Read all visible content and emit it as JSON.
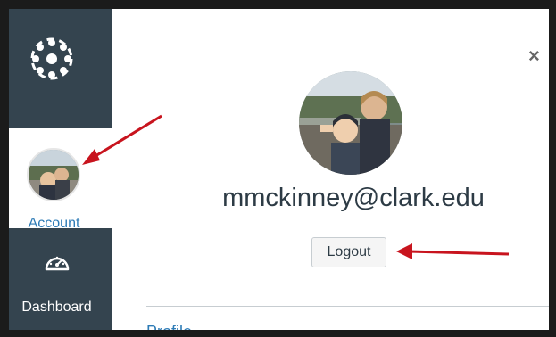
{
  "sidebar": {
    "account_label": "Account",
    "dashboard_label": "Dashboard"
  },
  "tray": {
    "username": "mmckinney@clark.edu",
    "logout_label": "Logout",
    "profile_link": "Profile",
    "close_glyph": "×"
  },
  "icons": {
    "logo": "canvas-logo-icon",
    "dashboard": "dashboard-gauge-icon",
    "close": "close-icon"
  },
  "annotations": {
    "arrow_color": "#c8141e"
  },
  "colors": {
    "sidebar_bg": "#34444f",
    "link": "#2d7bb6"
  }
}
